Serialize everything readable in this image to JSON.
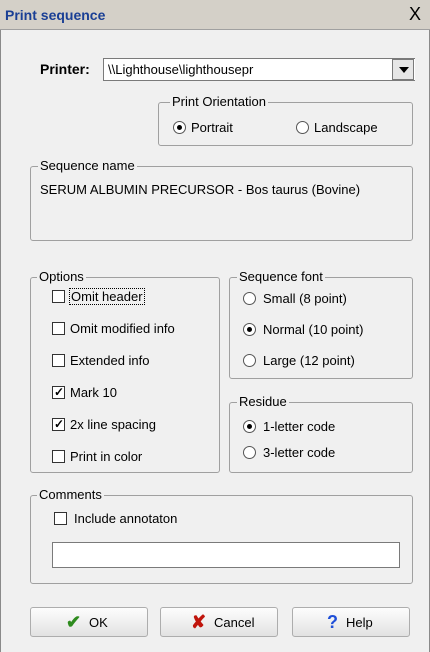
{
  "window": {
    "title": "Print sequence",
    "close_glyph": "X"
  },
  "printer": {
    "label": "Printer:",
    "value": "\\\\Lighthouse\\lighthousepr"
  },
  "orientation": {
    "legend": "Print Orientation",
    "options": [
      {
        "label": "Portrait",
        "selected": true
      },
      {
        "label": "Landscape",
        "selected": false
      }
    ]
  },
  "sequence_name": {
    "legend": "Sequence name",
    "value": "SERUM ALBUMIN PRECURSOR - Bos taurus (Bovine)"
  },
  "options": {
    "legend": "Options",
    "items": [
      {
        "label": "Omit header",
        "checked": false
      },
      {
        "label": "Omit modified info",
        "checked": false
      },
      {
        "label": "Extended info",
        "checked": false
      },
      {
        "label": "Mark 10",
        "checked": true
      },
      {
        "label": "2x line spacing",
        "checked": true
      },
      {
        "label": "Print in color",
        "checked": false
      }
    ]
  },
  "sequence_font": {
    "legend": "Sequence font",
    "options": [
      {
        "label": "Small (8 point)",
        "selected": false
      },
      {
        "label": "Normal (10 point)",
        "selected": true
      },
      {
        "label": "Large (12 point)",
        "selected": false
      }
    ]
  },
  "residue": {
    "legend": "Residue",
    "options": [
      {
        "label": "1-letter code",
        "selected": true
      },
      {
        "label": "3-letter code",
        "selected": false
      }
    ]
  },
  "comments": {
    "legend": "Comments",
    "include_label": "Include annotaton",
    "include_checked": false,
    "text_value": ""
  },
  "buttons": {
    "ok": {
      "label": "OK",
      "icon": "check-icon",
      "color": "#2e8b1e"
    },
    "cancel": {
      "label": "Cancel",
      "icon": "cross-icon",
      "color": "#c0150c"
    },
    "help": {
      "label": "Help",
      "icon": "question-icon",
      "color": "#1f4fd8"
    }
  }
}
